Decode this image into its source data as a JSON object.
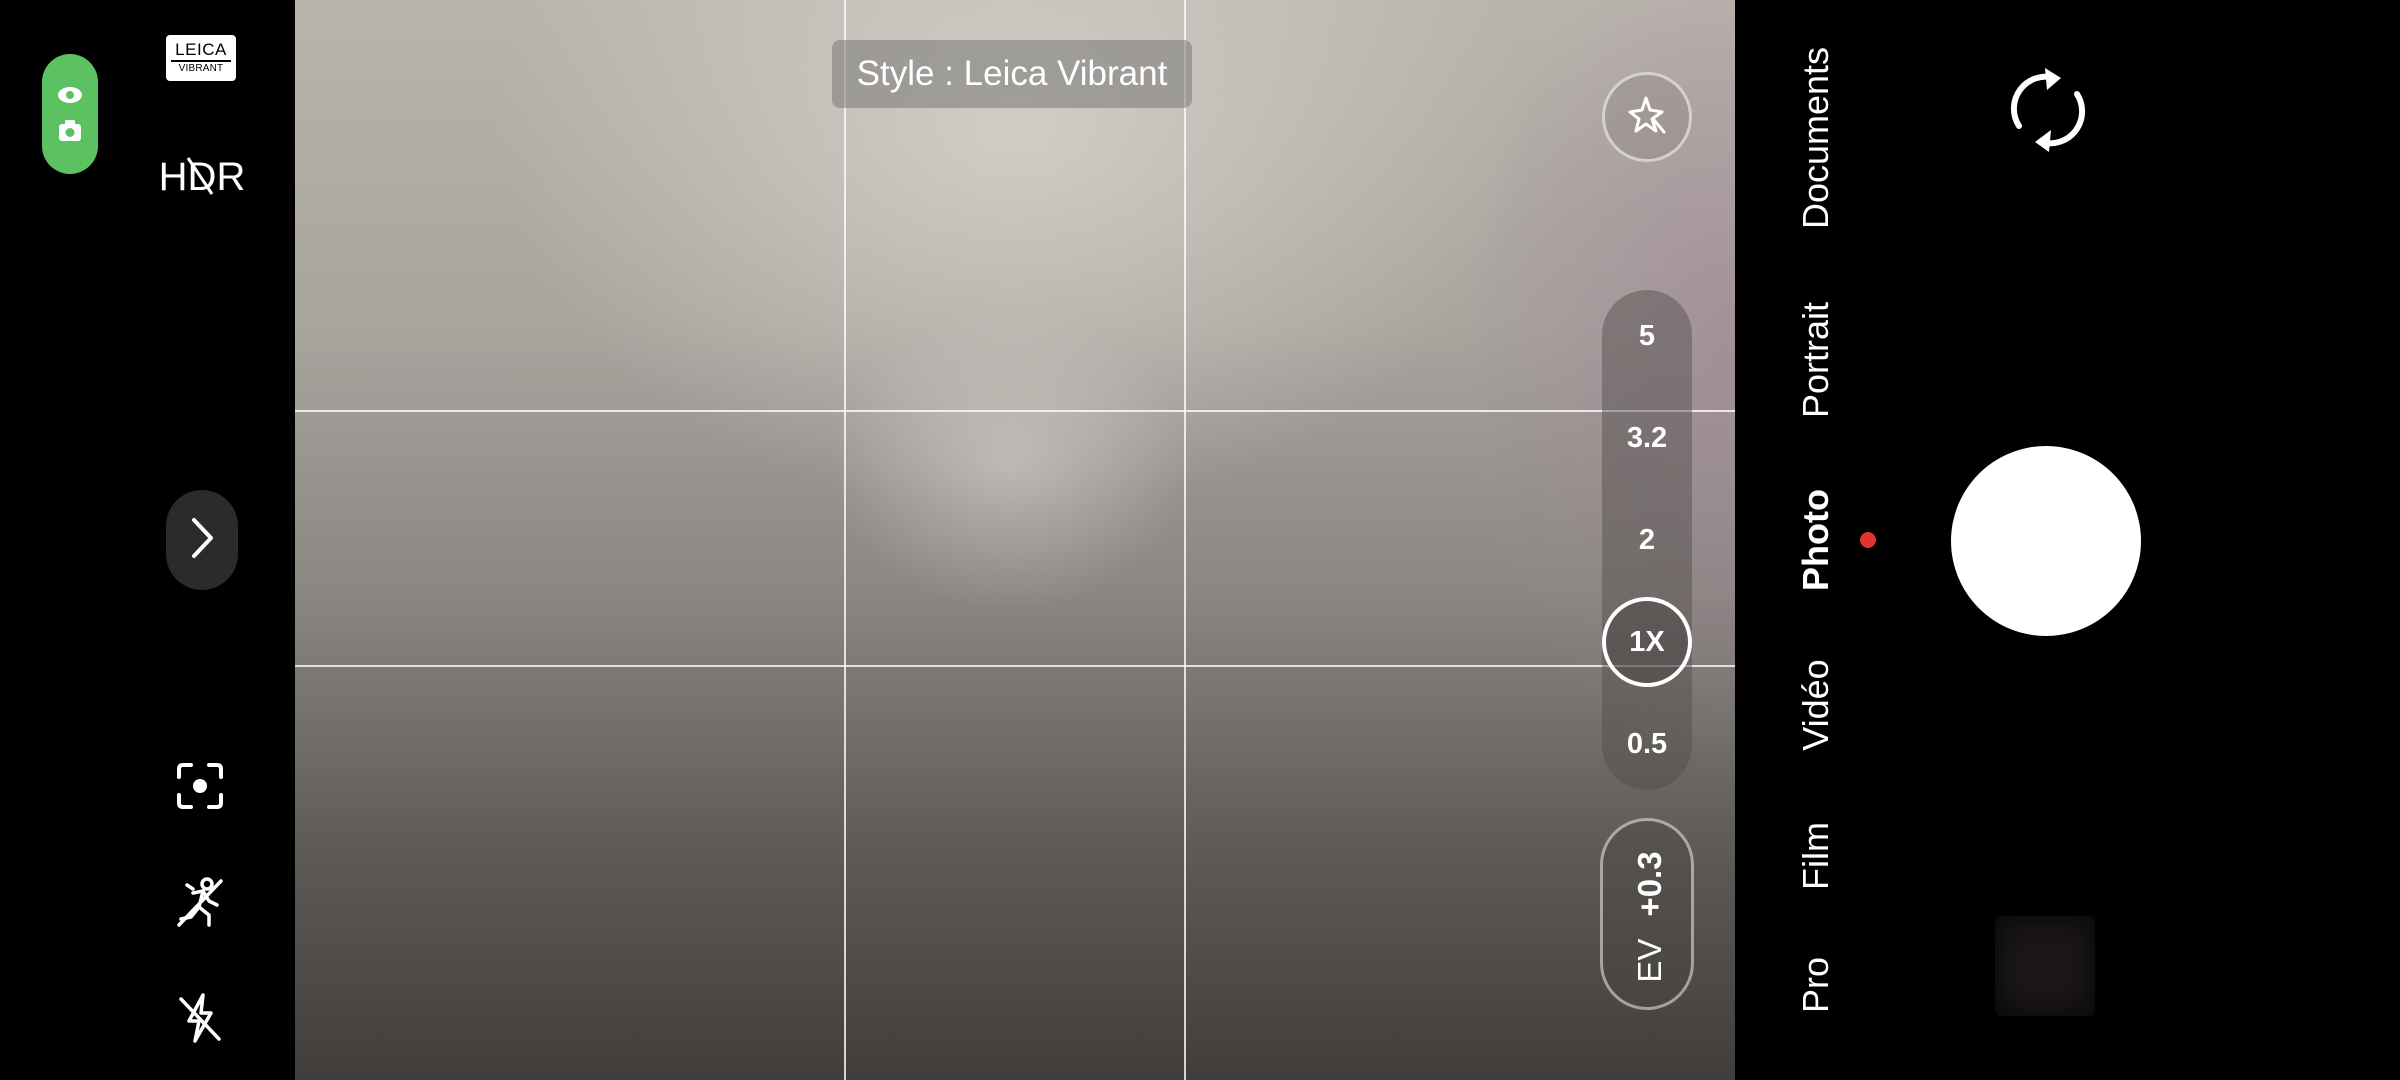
{
  "left_panel": {
    "camera_indicator": {
      "color": "#5cc160",
      "icons": [
        "eye-icon",
        "camera-small-icon"
      ]
    },
    "leica_badge": {
      "brand": "LEICA",
      "style": "VIBRANT"
    },
    "hdr_label": "HDR",
    "expand_icon": "chevron-right-icon",
    "tools": [
      "focus-frame-icon",
      "motion-off-icon",
      "flash-off-icon"
    ]
  },
  "viewfinder": {
    "style_label": "Style : Leica Vibrant",
    "ai_scene_icon": "sparkle-icon",
    "zoom": {
      "levels": [
        "5",
        "3.2",
        "2",
        "0.5"
      ],
      "current": "1X"
    },
    "exposure": {
      "label": "EV",
      "value": "+0.3"
    }
  },
  "right_panel": {
    "modes": [
      "Documents",
      "Portrait",
      "Photo",
      "Vidéo",
      "Film",
      "Pro"
    ],
    "active_mode": "Photo",
    "active_indicator_color": "#e0352f",
    "switch_camera_icon": "rotate-camera-icon"
  }
}
